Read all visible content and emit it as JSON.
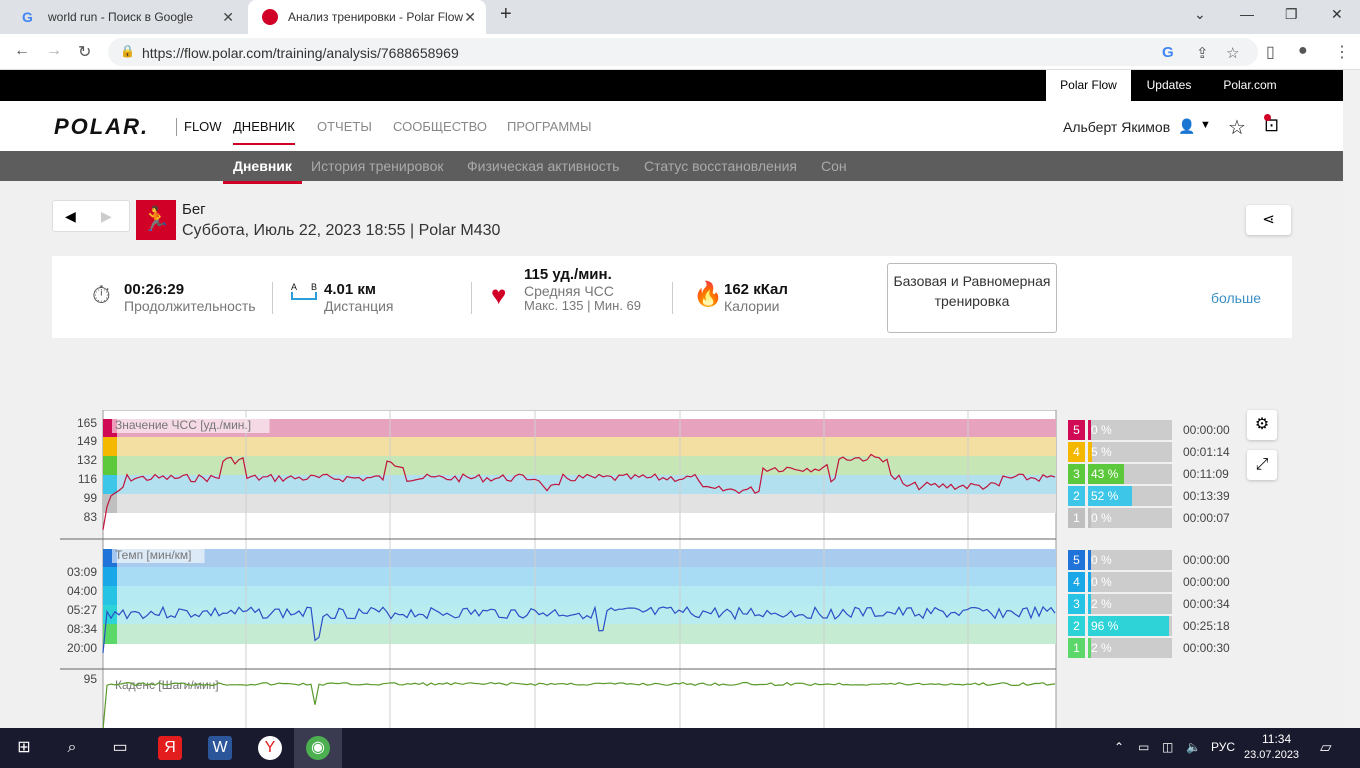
{
  "browser": {
    "tabs": [
      {
        "title": "world run - Поиск в Google",
        "active": false
      },
      {
        "title": "Анализ тренировки - Polar Flow",
        "active": true
      }
    ],
    "url": "https://flow.polar.com/training/analysis/7688658969"
  },
  "topbar": {
    "items": [
      "Polar Flow",
      "Updates",
      "Polar.com"
    ]
  },
  "mainnav": {
    "logo": "POLAR.",
    "flow": "FLOW",
    "items": [
      "ДНЕВНИК",
      "ОТЧЕТЫ",
      "СООБЩЕСТВО",
      "ПРОГРАММЫ"
    ],
    "user": "Альберт Якимов"
  },
  "subnav": {
    "items": [
      "Дневник",
      "История тренировок",
      "Физическая активность",
      "Статус восстановления",
      "Сон"
    ]
  },
  "exercise": {
    "sport": "Бег",
    "details": "Суббота, Июль 22, 2023 18:55 | Polar M430"
  },
  "summary": {
    "duration": {
      "value": "00:26:29",
      "label": "Продолжительность"
    },
    "distance": {
      "value": "4.01 км",
      "label": "Дистанция",
      "icon_ab": "A B"
    },
    "hr": {
      "value": "115 уд./мин.",
      "label": "Средняя ЧСС",
      "minmax": "Макс. 135  |  Мин. 69"
    },
    "calories": {
      "value": "162 кКал",
      "label": "Калории"
    },
    "phase": "Базовая и Равномерная тренировка",
    "more": "больше"
  },
  "charts": {
    "hr": {
      "label": "Значение ЧСС [уд./мин.]",
      "ticks": [
        "165",
        "149",
        "132",
        "116",
        "99",
        "83"
      ],
      "zones": [
        {
          "num": "5",
          "pct": "0 %",
          "frac": 0,
          "time": "00:00:00",
          "color": "#d10a55"
        },
        {
          "num": "4",
          "pct": "5 %",
          "frac": 0.05,
          "time": "00:01:14",
          "color": "#f5b800"
        },
        {
          "num": "3",
          "pct": "43 %",
          "frac": 0.43,
          "time": "00:11:09",
          "color": "#5cc83b"
        },
        {
          "num": "2",
          "pct": "52 %",
          "frac": 0.52,
          "time": "00:13:39",
          "color": "#3ec6e8"
        },
        {
          "num": "1",
          "pct": "0 %",
          "frac": 0,
          "time": "00:00:07",
          "color": "#bfbfbf"
        }
      ]
    },
    "pace": {
      "label": "Темп [мин/км]",
      "ticks": [
        "03:09",
        "04:00",
        "05:27",
        "08:34",
        "20:00"
      ],
      "zones": [
        {
          "num": "5",
          "pct": "0 %",
          "frac": 0,
          "time": "00:00:00",
          "color": "#2073d8"
        },
        {
          "num": "4",
          "pct": "0 %",
          "frac": 0,
          "time": "00:00:00",
          "color": "#1aa7e8"
        },
        {
          "num": "3",
          "pct": "2 %",
          "frac": 0.02,
          "time": "00:00:34",
          "color": "#27c3e5"
        },
        {
          "num": "2",
          "pct": "96 %",
          "frac": 0.96,
          "time": "00:25:18",
          "color": "#2ed3d8"
        },
        {
          "num": "1",
          "pct": "2 %",
          "frac": 0.02,
          "time": "00:00:30",
          "color": "#5cd86a"
        }
      ]
    },
    "cadence": {
      "label": "Каденс [Шаги/мин]",
      "ticks": [
        "95"
      ]
    }
  },
  "taskbar": {
    "lang": "РУС",
    "time": "11:34",
    "date": "23.07.2023"
  }
}
